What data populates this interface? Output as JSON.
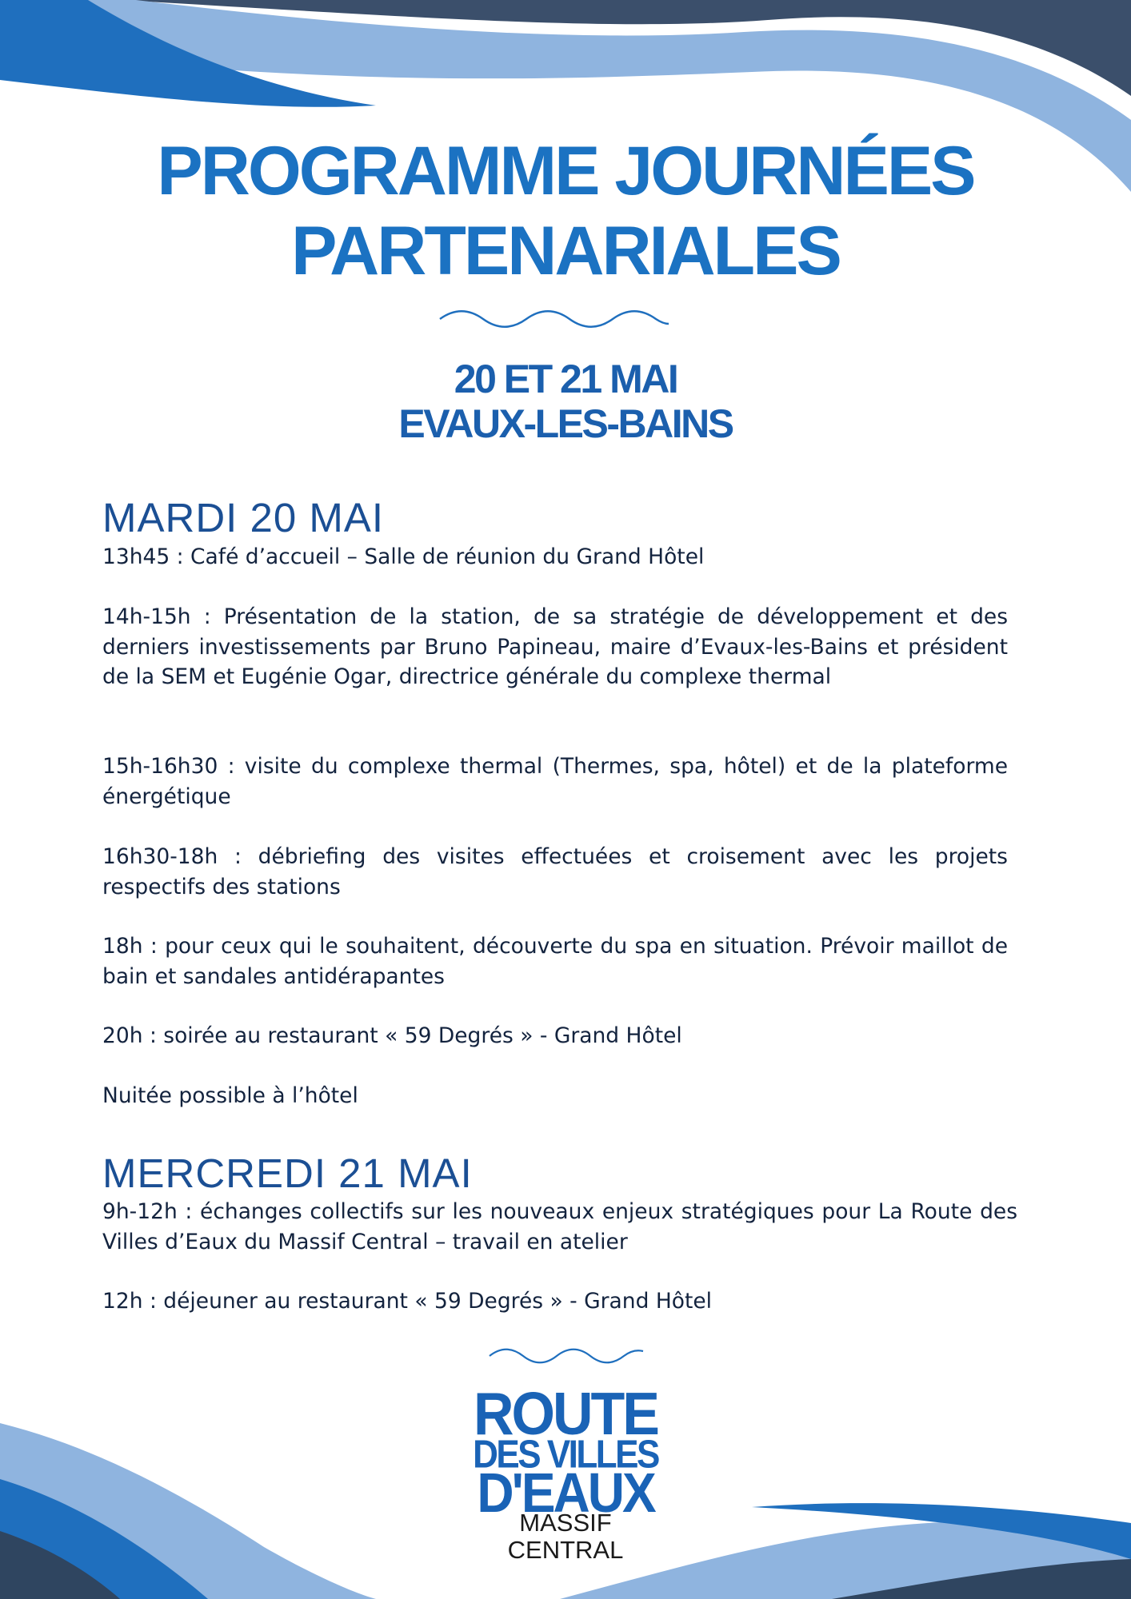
{
  "header": {
    "title_line1": "PROGRAMME JOURNÉES",
    "title_line2": "PARTENARIALES",
    "date": "20 ET 21 MAI",
    "location": "EVAUX-LES-BAINS"
  },
  "days": [
    {
      "heading": "MARDI 20 MAI",
      "items": [
        "13h45 : Café d’accueil – Salle de réunion du Grand Hôtel",
        "14h-15h : Présentation de la station, de sa stratégie de développement et des derniers investissements par Bruno Papineau, maire d’Evaux-les-Bains et président de la SEM et Eugénie Ogar, directrice générale du complexe thermal",
        "15h-16h30 : visite du complexe thermal (Thermes, spa, hôtel) et de la plateforme énergétique",
        "16h30-18h : débriefing des visites effectuées et croisement avec les projets respectifs des stations",
        "18h : pour ceux qui le souhaitent, découverte du spa en situation. Prévoir maillot de bain et sandales antidérapantes",
        "20h : soirée au restaurant « 59 Degrés » - Grand Hôtel",
        "Nuitée possible à l’hôtel"
      ]
    },
    {
      "heading": "MERCREDI 21 MAI",
      "items": [
        "9h-12h : échanges collectifs sur les nouveaux enjeux stratégiques pour La Route des Villes d’Eaux du Massif Central – travail en atelier",
        "12h : déjeuner au restaurant « 59 Degrés » - Grand Hôtel"
      ]
    }
  ],
  "logo": {
    "line1": "ROUTE",
    "line2": "DES VILLES",
    "line3": "D'EAUX",
    "line4": "MASSIF CENTRAL"
  },
  "colors": {
    "primary_blue": "#1b72c2",
    "light_blue": "#8fb4df",
    "dark_navy": "#33455e",
    "text": "#13233e"
  }
}
